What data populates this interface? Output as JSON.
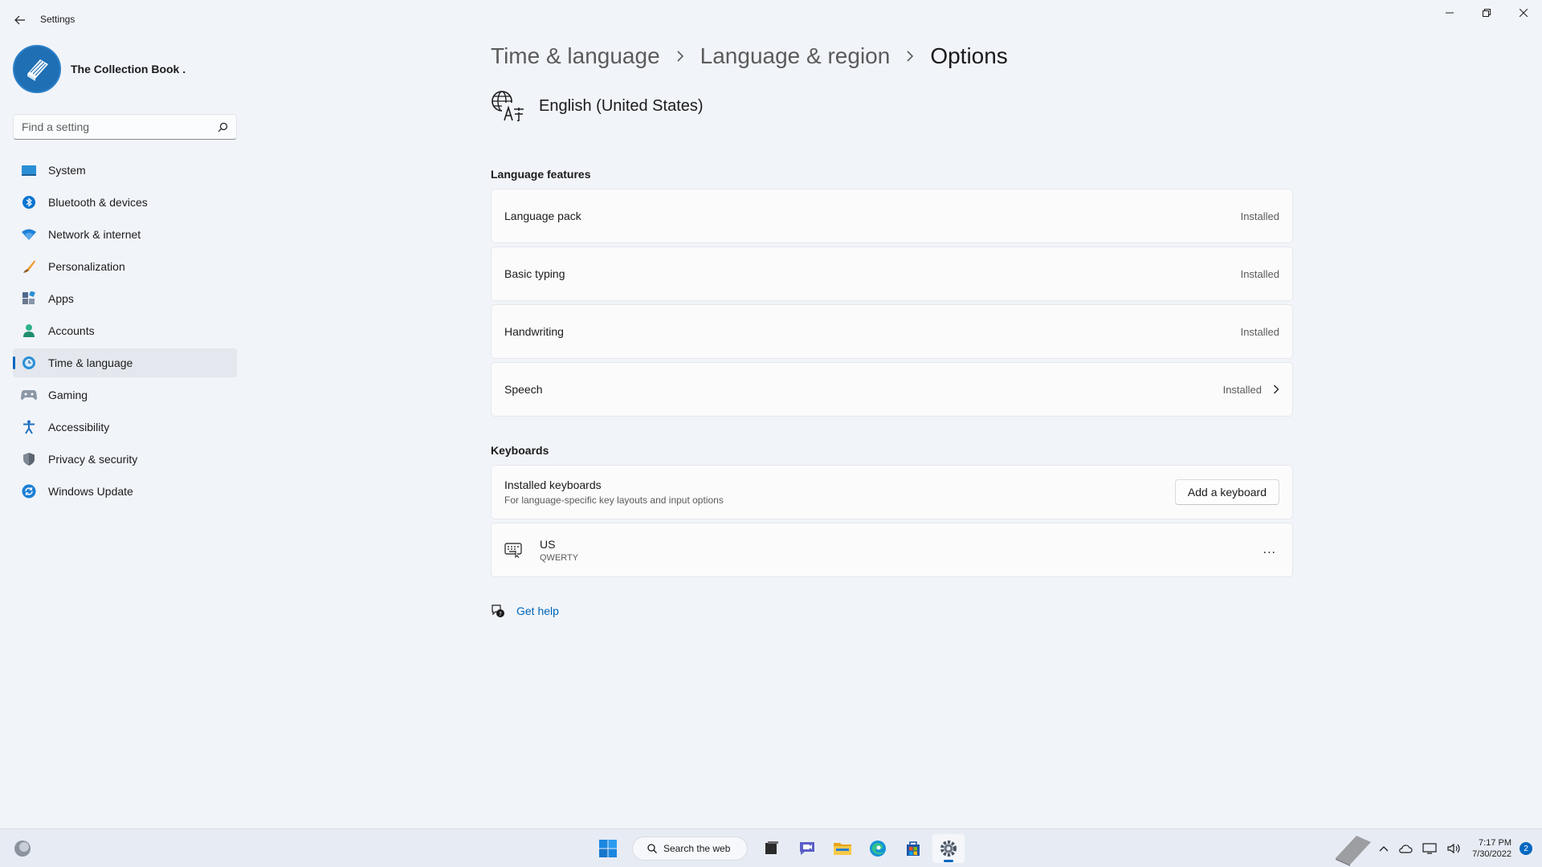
{
  "window": {
    "title": "Settings"
  },
  "profile": {
    "name": "The Collection Book ."
  },
  "search": {
    "placeholder": "Find a setting"
  },
  "sidebar": {
    "items": [
      {
        "label": "System",
        "icon": "system-icon"
      },
      {
        "label": "Bluetooth & devices",
        "icon": "bluetooth-icon"
      },
      {
        "label": "Network & internet",
        "icon": "wifi-icon"
      },
      {
        "label": "Personalization",
        "icon": "brush-icon"
      },
      {
        "label": "Apps",
        "icon": "apps-icon"
      },
      {
        "label": "Accounts",
        "icon": "person-icon"
      },
      {
        "label": "Time & language",
        "icon": "clock-globe-icon",
        "active": true
      },
      {
        "label": "Gaming",
        "icon": "gamepad-icon"
      },
      {
        "label": "Accessibility",
        "icon": "accessibility-icon"
      },
      {
        "label": "Privacy & security",
        "icon": "shield-icon"
      },
      {
        "label": "Windows Update",
        "icon": "update-icon"
      }
    ]
  },
  "breadcrumb": {
    "items": [
      "Time & language",
      "Language & region",
      "Options"
    ]
  },
  "language": {
    "title": "English (United States)"
  },
  "features": {
    "section_title": "Language features",
    "items": [
      {
        "label": "Language pack",
        "status": "Installed"
      },
      {
        "label": "Basic typing",
        "status": "Installed"
      },
      {
        "label": "Handwriting",
        "status": "Installed"
      },
      {
        "label": "Speech",
        "status": "Installed"
      }
    ]
  },
  "keyboards": {
    "section_title": "Keyboards",
    "installed_label": "Installed keyboards",
    "installed_desc": "For language-specific key layouts and input options",
    "add_button": "Add a keyboard",
    "list": [
      {
        "name": "US",
        "layout": "QWERTY"
      }
    ],
    "more_label": "..."
  },
  "help": {
    "label": "Get help"
  },
  "taskbar": {
    "search_label": "Search the web",
    "time": "7:17 PM",
    "date": "7/30/2022",
    "notification_count": "2"
  },
  "colors": {
    "accent": "#0067c0",
    "background": "#f1f4f9",
    "card": "#fbfbfc"
  }
}
